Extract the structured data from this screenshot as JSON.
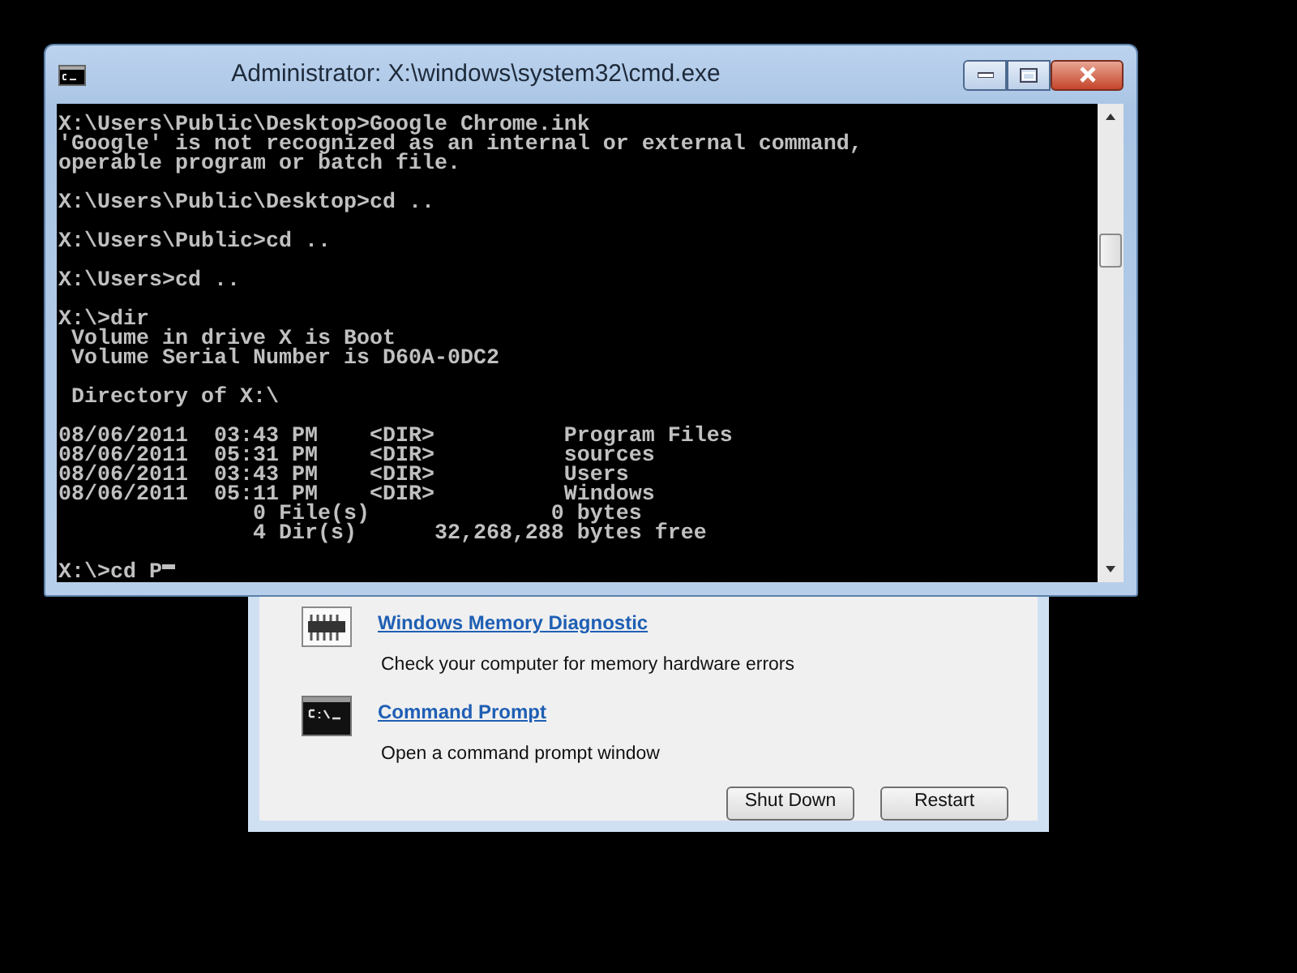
{
  "recovery_dialog": {
    "tools": [
      {
        "kind": "memory",
        "title": "Windows Memory Diagnostic",
        "description": "Check your computer for memory hardware errors"
      },
      {
        "kind": "console",
        "title": "Command Prompt",
        "description": "Open a command prompt window"
      }
    ],
    "buttons": [
      "Shut Down",
      "Restart"
    ]
  },
  "cmd_window": {
    "title": "Administrator: X:\\windows\\system32\\cmd.exe",
    "blocks": [
      [
        "X:\\Users\\Public\\Desktop>Google Chrome.ink",
        "'Google' is not recognized as an internal or external command,",
        "operable program or batch file."
      ],
      [
        "X:\\Users\\Public\\Desktop>cd .."
      ],
      [
        "X:\\Users\\Public>cd .."
      ],
      [
        "X:\\Users>cd .."
      ],
      [
        "X:\\>dir",
        " Volume in drive X is Boot",
        " Volume Serial Number is D60A-0DC2"
      ],
      [
        " Directory of X:\\"
      ],
      [
        "08/06/2011  03:43 PM    <DIR>          Program Files",
        "08/06/2011  05:31 PM    <DIR>          sources",
        "08/06/2011  03:43 PM    <DIR>          Users",
        "08/06/2011  05:11 PM    <DIR>          Windows",
        "               0 File(s)              0 bytes",
        "               4 Dir(s)      32,268,288 bytes free"
      ]
    ],
    "input": "X:\\>cd P"
  }
}
